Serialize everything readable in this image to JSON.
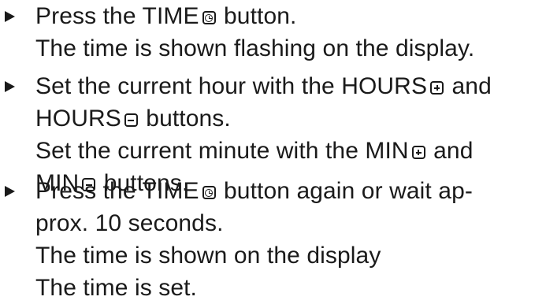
{
  "steps": [
    {
      "lines": [
        {
          "a": "Press the TIME",
          "b": " button."
        },
        {
          "a": "The time is shown flashing on the display."
        }
      ]
    },
    {
      "lines": [
        {
          "a": "Set the current hour with the HOURS",
          "b": " and"
        },
        {
          "a": "HOURS",
          "b": " buttons."
        },
        {
          "a": "Set the current minute with the MIN",
          "b": " and"
        },
        {
          "a": "MIN",
          "b": " buttons."
        }
      ]
    },
    {
      "lines": [
        {
          "a": "Press the TIME",
          "b": " button again or wait ap-"
        },
        {
          "a": "prox. 10 seconds."
        },
        {
          "a": "The time is shown on the display"
        },
        {
          "a": "The time is set."
        }
      ]
    }
  ],
  "icons": {
    "time": "clock-icon",
    "plus": "plus-icon",
    "minus": "minus-icon"
  }
}
